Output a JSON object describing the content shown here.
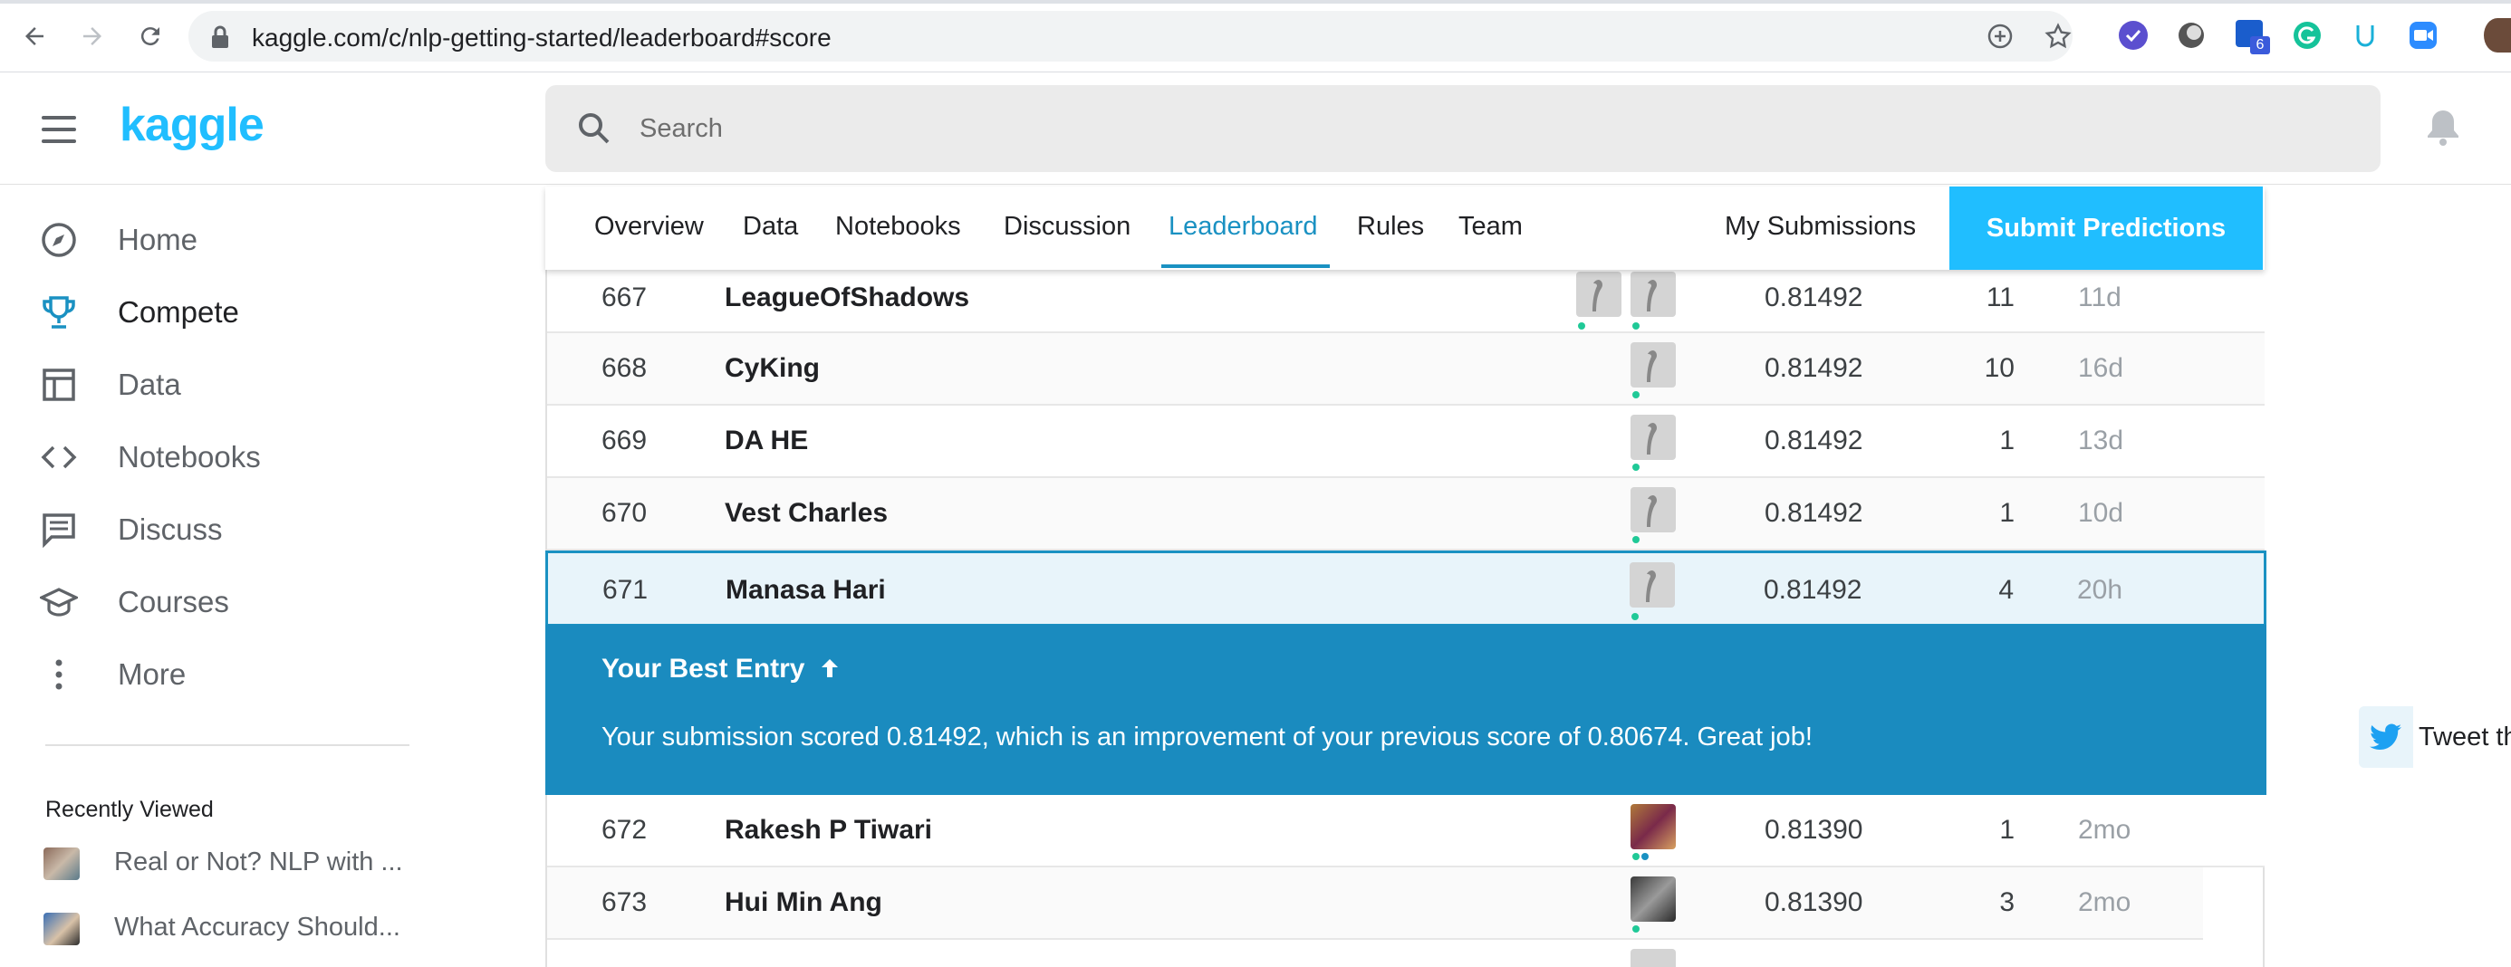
{
  "browser": {
    "url": "kaggle.com/c/nlp-getting-started/leaderboard#score",
    "extension_badge": "6"
  },
  "header": {
    "logo": "kaggle",
    "search_placeholder": "Search"
  },
  "sidebar": {
    "items": [
      {
        "label": "Home",
        "icon": "compass-icon"
      },
      {
        "label": "Compete",
        "icon": "trophy-icon"
      },
      {
        "label": "Data",
        "icon": "table-icon"
      },
      {
        "label": "Notebooks",
        "icon": "code-icon"
      },
      {
        "label": "Discuss",
        "icon": "comment-icon"
      },
      {
        "label": "Courses",
        "icon": "graduation-cap-icon"
      },
      {
        "label": "More",
        "icon": "more-vertical-icon"
      }
    ],
    "recent_title": "Recently Viewed",
    "recent": [
      {
        "label": "Real or Not? NLP with ..."
      },
      {
        "label": "What Accuracy Should..."
      }
    ]
  },
  "tabs": {
    "items": [
      "Overview",
      "Data",
      "Notebooks",
      "Discussion",
      "Leaderboard",
      "Rules",
      "Team"
    ],
    "my_submissions": "My Submissions",
    "submit": "Submit Predictions"
  },
  "leaderboard": {
    "rows": [
      {
        "rank": "667",
        "team": "LeagueOfShadows",
        "score": "0.81492",
        "entries": "11",
        "last": "11d"
      },
      {
        "rank": "668",
        "team": "CyKing",
        "score": "0.81492",
        "entries": "10",
        "last": "16d"
      },
      {
        "rank": "669",
        "team": "DA HE",
        "score": "0.81492",
        "entries": "1",
        "last": "13d"
      },
      {
        "rank": "670",
        "team": "Vest Charles",
        "score": "0.81492",
        "entries": "1",
        "last": "10d"
      },
      {
        "rank": "671",
        "team": "Manasa Hari",
        "score": "0.81492",
        "entries": "4",
        "last": "20h"
      },
      {
        "rank": "672",
        "team": "Rakesh P Tiwari",
        "score": "0.81390",
        "entries": "1",
        "last": "2mo"
      },
      {
        "rank": "673",
        "team": "Hui Min Ang",
        "score": "0.81390",
        "entries": "3",
        "last": "2mo"
      }
    ],
    "best_entry": {
      "title": "Your Best Entry",
      "message": "Your submission scored 0.81492, which is an improvement of your previous score of 0.80674. Great job!",
      "tweet": "Tweet this!"
    }
  },
  "colors": {
    "brand": "#20beff",
    "active_tab": "#1a91c2",
    "best_entry_bg": "#1a8bbf"
  }
}
